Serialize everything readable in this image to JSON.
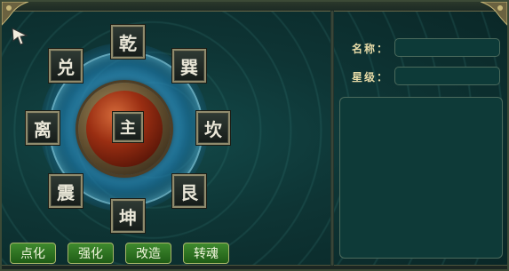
{
  "bagua": {
    "center": "主",
    "trigrams": {
      "qian": "乾",
      "xun": "巽",
      "kan": "坎",
      "gen": "艮",
      "kun": "坤",
      "zhen": "震",
      "li": "离",
      "dui": "兑"
    }
  },
  "info_panel": {
    "name_label": "名称：",
    "name_value": "",
    "star_label": "星级：",
    "star_value": "",
    "description": ""
  },
  "actions": {
    "dianhua": "点化",
    "qianghua": "强化",
    "gaizao": "改造",
    "zhuanhun": "转魂"
  },
  "colors": {
    "accent_green": "#2f7a22",
    "panel_teal": "#0e3a38",
    "label_gold": "#e8dca8"
  },
  "icons": [
    "arrow-cursor-icon"
  ]
}
